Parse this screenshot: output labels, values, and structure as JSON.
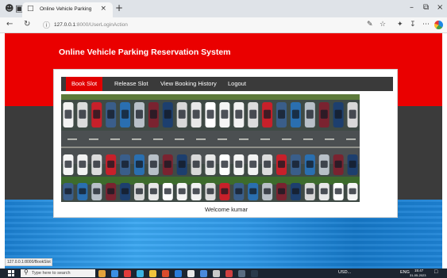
{
  "browser": {
    "tab_title": "Online Vehicle Parking",
    "url_host": "127.0.0.1",
    "url_path": ":8000/UserLoginAction",
    "status_url": "127.0.0.1:8000/BookSlot"
  },
  "site": {
    "title": "Online Vehicle Parking Reservation System",
    "menu": [
      "Book Slot",
      "Release Slot",
      "View Booking History",
      "Logout"
    ],
    "active_menu": "Book Slot",
    "welcome": "Welcome kumar",
    "colors": {
      "header_red": "#ea0000",
      "dark_band": "#3b3b3b",
      "blue_band": "#2e97e6",
      "menu_bg": "#3a3a3a",
      "menu_active": "#e10000"
    },
    "hero_image": "aerial-parking-lot-image"
  },
  "taskbar": {
    "search_placeholder": "Type here to search",
    "weather": "USD...",
    "lang": "ENG",
    "time": "15:47",
    "date": "31-05-2023"
  },
  "icons": [
    "user-icon",
    "tab-switch-icon",
    "document-icon",
    "close-icon",
    "new-tab-icon",
    "back-icon",
    "refresh-icon",
    "info-icon",
    "read-aloud-icon",
    "favorite-icon",
    "collections-icon",
    "downloads-icon",
    "more-icon",
    "edge-icon",
    "windows-start-icon",
    "search-icon"
  ]
}
